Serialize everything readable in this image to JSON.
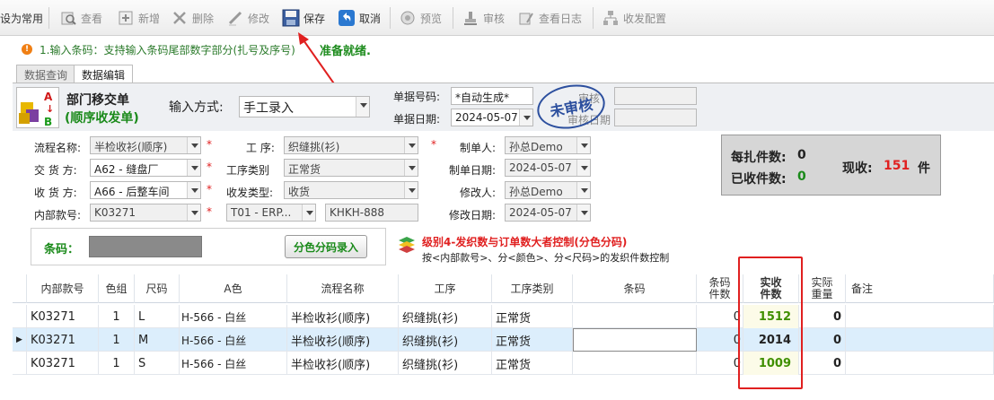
{
  "toolbar": {
    "set_common": "设为常用",
    "view": "查看",
    "add": "新增",
    "delete": "删除",
    "edit": "修改",
    "save": "保存",
    "cancel": "取消",
    "preview": "预览",
    "review": "审核",
    "review_log": "查看日志",
    "config": "收发配置"
  },
  "message": {
    "text": "1.输入条码：支持输入条码尾部数字部分(扎号及序号)",
    "status": "准备就绪."
  },
  "tabs": [
    "数据查询",
    "数据编辑"
  ],
  "header": {
    "title": "部门移交单",
    "subtitle": "(顺序收发单)",
    "input_mode_label": "输入方式:",
    "input_mode_value": "手工录入",
    "doc_no_label": "单据号码:",
    "doc_no_value": "*自动生成*",
    "doc_date_label": "单据日期:",
    "doc_date_value": "2024-05-07",
    "review_label": "审核",
    "review_date_label": "审核日期",
    "stamp": "未审核"
  },
  "form": {
    "process_name_label": "流程名称:",
    "process_name_value": "半检收衫(顺序)",
    "deliver_label": "交 货 方:",
    "deliver_value": "A62 - 缝盘厂",
    "receive_label": "收 货 方:",
    "receive_value": "A66 - 后整车间",
    "internal_no_label": "内部款号:",
    "internal_no_value": "K03271",
    "operation_label": "工 序:",
    "operation_value": "织缝挑(衫)",
    "op_type_label": "工序类别",
    "op_type_value": "正常货",
    "rs_type_label": "收发类型:",
    "rs_type_value": "收货",
    "erp_value": "T01 - ERP...",
    "khkh_value": "KHKH-888",
    "maker_label": "制单人:",
    "maker_value": "孙总Demo",
    "make_date_label": "制单日期:",
    "make_date_value": "2024-05-07",
    "modifier_label": "修改人:",
    "modifier_value": "孙总Demo",
    "modify_date_label": "修改日期:",
    "modify_date_value": "2024-05-07"
  },
  "stats": {
    "per_bundle_label": "每扎件数:",
    "per_bundle_value": "0",
    "received_label": "已收件数:",
    "received_value": "0",
    "current_label": "现收:",
    "current_value": "151",
    "unit": "件"
  },
  "barcode": {
    "label": "条码：",
    "button": "分色分码录入",
    "level_text": "级别4-发织数与订单数大者控制(分色分码)",
    "level_sub": "按<内部款号>、分<颜色>、分<尺码>的发织件数控制"
  },
  "grid": {
    "headers": [
      "内部款号",
      "色组",
      "尺码",
      "A色",
      "流程名称",
      "工序",
      "工序类别",
      "条码",
      "条码件数",
      "实收件数",
      "实际重量",
      "备注"
    ],
    "rows": [
      {
        "code": "K03271",
        "group": "1",
        "size": "L",
        "color": "H-566 - 白丝",
        "process": "半检收衫(顺序)",
        "op": "织缝挑(衫)",
        "optype": "正常货",
        "barcode": "",
        "bc_qty": "0",
        "qty": "1512",
        "weight": "0",
        "note": ""
      },
      {
        "code": "K03271",
        "group": "1",
        "size": "M",
        "color": "H-566 - 白丝",
        "process": "半检收衫(顺序)",
        "op": "织缝挑(衫)",
        "optype": "正常货",
        "barcode": "",
        "bc_qty": "0",
        "qty": "2014",
        "weight": "0",
        "note": ""
      },
      {
        "code": "K03271",
        "group": "1",
        "size": "S",
        "color": "H-566 - 白丝",
        "process": "半检收衫(顺序)",
        "op": "织缝挑(衫)",
        "optype": "正常货",
        "barcode": "",
        "bc_qty": "0",
        "qty": "1009",
        "weight": "0",
        "note": ""
      }
    ]
  },
  "colors": {
    "accent_red": "#e02020",
    "green_text": "#2a7a2a",
    "qty_green": "#3f8f00",
    "stamp_blue": "#2c4f9e"
  }
}
